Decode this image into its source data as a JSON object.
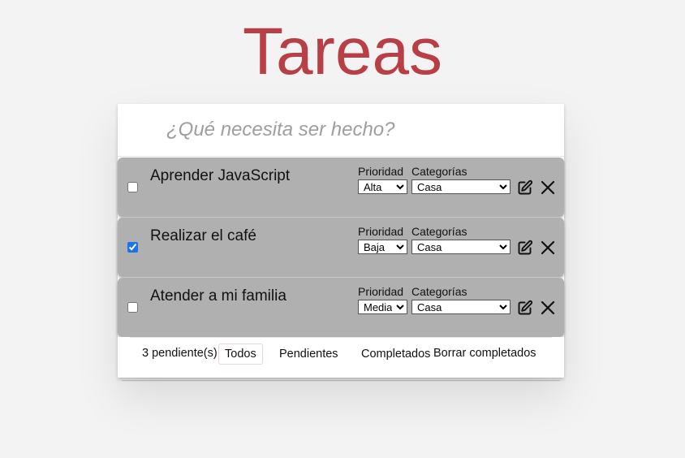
{
  "header": {
    "title": "Tareas"
  },
  "new_todo": {
    "placeholder": "¿Qué necesita ser hecho?"
  },
  "todos": [
    {
      "label": "Aprender JavaScript",
      "completed": false,
      "priority_label": "Prioridad",
      "priority": "Alta",
      "category_label": "Categorías",
      "category": "Casa"
    },
    {
      "label": "Realizar el café",
      "completed": true,
      "priority_label": "Prioridad",
      "priority": "Baja",
      "category_label": "Categorías",
      "category": "Casa"
    },
    {
      "label": "Atender a mi familia",
      "completed": false,
      "priority_label": "Prioridad",
      "priority": "Media",
      "category_label": "Categorías",
      "category": "Casa"
    }
  ],
  "footer": {
    "count": "3 pendiente(s)",
    "filters": [
      "Todos",
      "Pendientes",
      "Completados"
    ],
    "selected_filter": "Todos",
    "clear": "Borrar completados"
  },
  "icons": {
    "edit": "edit-pencil-square-icon",
    "delete": "close-x-icon"
  },
  "colors": {
    "title": "#b83f45",
    "todo_background": "#b0b0b0",
    "page_background": "#f3f3f3"
  }
}
